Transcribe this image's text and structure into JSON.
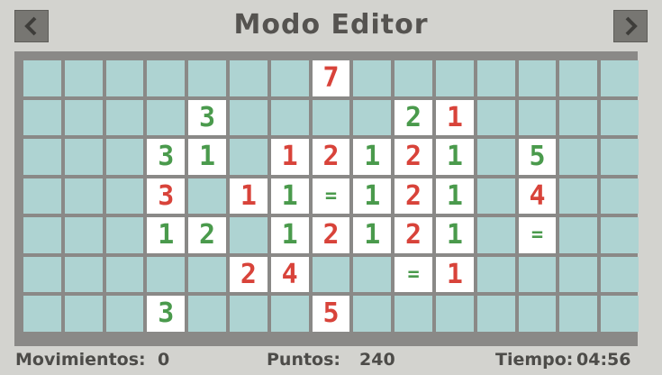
{
  "header": {
    "title": "Modo Editor",
    "back_icon": "chevron-left-icon",
    "forward_icon": "chevron-right-icon"
  },
  "colors": {
    "red": "#d8433a",
    "green": "#4a9a4c",
    "empty": "#aed3d2",
    "tile": "#ffffff"
  },
  "board": {
    "cols": 15,
    "rows": 7,
    "tiles": [
      {
        "row": 0,
        "col": 7,
        "text": "7",
        "color": "red"
      },
      {
        "row": 1,
        "col": 4,
        "text": "3",
        "color": "green"
      },
      {
        "row": 1,
        "col": 9,
        "text": "2",
        "color": "green"
      },
      {
        "row": 1,
        "col": 10,
        "text": "1",
        "color": "red"
      },
      {
        "row": 2,
        "col": 3,
        "text": "3",
        "color": "green"
      },
      {
        "row": 2,
        "col": 4,
        "text": "1",
        "color": "green"
      },
      {
        "row": 2,
        "col": 6,
        "text": "1",
        "color": "red"
      },
      {
        "row": 2,
        "col": 7,
        "text": "2",
        "color": "red"
      },
      {
        "row": 2,
        "col": 8,
        "text": "1",
        "color": "green"
      },
      {
        "row": 2,
        "col": 9,
        "text": "2",
        "color": "red"
      },
      {
        "row": 2,
        "col": 10,
        "text": "1",
        "color": "green"
      },
      {
        "row": 2,
        "col": 12,
        "text": "5",
        "color": "green"
      },
      {
        "row": 3,
        "col": 3,
        "text": "3",
        "color": "red"
      },
      {
        "row": 3,
        "col": 5,
        "text": "1",
        "color": "red"
      },
      {
        "row": 3,
        "col": 6,
        "text": "1",
        "color": "green"
      },
      {
        "row": 3,
        "col": 7,
        "text": "=",
        "color": "green"
      },
      {
        "row": 3,
        "col": 8,
        "text": "1",
        "color": "green"
      },
      {
        "row": 3,
        "col": 9,
        "text": "2",
        "color": "red"
      },
      {
        "row": 3,
        "col": 10,
        "text": "1",
        "color": "green"
      },
      {
        "row": 3,
        "col": 12,
        "text": "4",
        "color": "red"
      },
      {
        "row": 4,
        "col": 3,
        "text": "1",
        "color": "green"
      },
      {
        "row": 4,
        "col": 4,
        "text": "2",
        "color": "green"
      },
      {
        "row": 4,
        "col": 6,
        "text": "1",
        "color": "green"
      },
      {
        "row": 4,
        "col": 7,
        "text": "2",
        "color": "red"
      },
      {
        "row": 4,
        "col": 8,
        "text": "1",
        "color": "green"
      },
      {
        "row": 4,
        "col": 9,
        "text": "2",
        "color": "red"
      },
      {
        "row": 4,
        "col": 10,
        "text": "1",
        "color": "green"
      },
      {
        "row": 4,
        "col": 12,
        "text": "=",
        "color": "green"
      },
      {
        "row": 5,
        "col": 5,
        "text": "2",
        "color": "red"
      },
      {
        "row": 5,
        "col": 6,
        "text": "4",
        "color": "red"
      },
      {
        "row": 5,
        "col": 9,
        "text": "=",
        "color": "green"
      },
      {
        "row": 5,
        "col": 10,
        "text": "1",
        "color": "red"
      },
      {
        "row": 6,
        "col": 3,
        "text": "3",
        "color": "green"
      },
      {
        "row": 6,
        "col": 7,
        "text": "5",
        "color": "red"
      }
    ]
  },
  "footer": {
    "moves_label": "Movimientos:",
    "moves_value": "0",
    "points_label": "Puntos:",
    "points_value": "240",
    "time_label": "Tiempo:",
    "time_value": "04:56"
  }
}
